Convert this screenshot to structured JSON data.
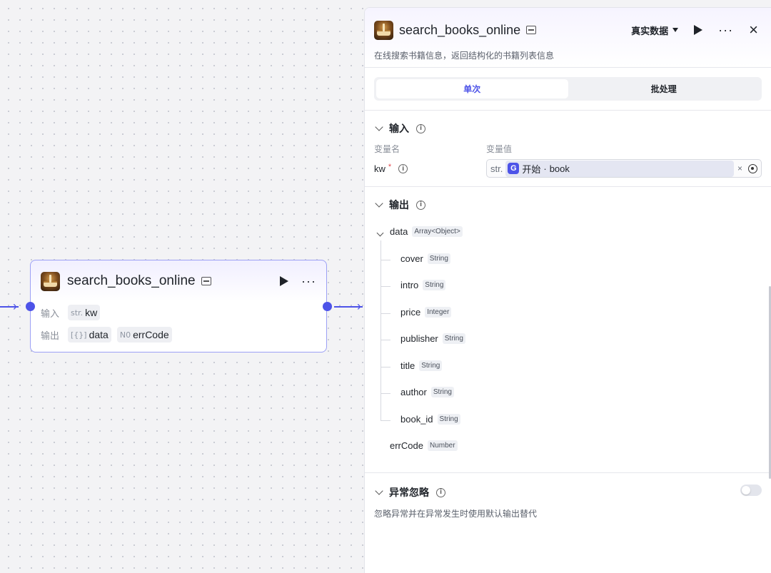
{
  "node": {
    "title": "search_books_online",
    "input_label": "输入",
    "output_label": "输出",
    "inputs": [
      {
        "type": "str.",
        "name": "kw"
      }
    ],
    "outputs": [
      {
        "type": "[{}]",
        "name": "data"
      },
      {
        "type": "N0",
        "name": "errCode"
      }
    ]
  },
  "panel": {
    "title": "search_books_online",
    "data_mode": "真实数据",
    "description": "在线搜索书籍信息，返回结构化的书籍列表信息",
    "tabs": [
      "单次",
      "批处理"
    ],
    "active_tab": "单次",
    "input_section": {
      "title": "输入",
      "col_name": "变量名",
      "col_value": "变量值",
      "var_name": "kw",
      "required_mark": "*",
      "value_type": "str.",
      "ref_node": "开始",
      "ref_sep": " · ",
      "ref_var": "book",
      "clear": "×"
    },
    "output_section": {
      "title": "输出",
      "root": {
        "name": "data",
        "type": "Array<Object>"
      },
      "children": [
        {
          "name": "cover",
          "type": "String"
        },
        {
          "name": "intro",
          "type": "String"
        },
        {
          "name": "price",
          "type": "Integer"
        },
        {
          "name": "publisher",
          "type": "String"
        },
        {
          "name": "title",
          "type": "String"
        },
        {
          "name": "author",
          "type": "String"
        },
        {
          "name": "book_id",
          "type": "String"
        }
      ],
      "extra": {
        "name": "errCode",
        "type": "Number"
      }
    },
    "ignore_section": {
      "title": "异常忽略",
      "description": "忽略异常并在异常发生时使用默认输出替代",
      "enabled": false
    }
  },
  "colors": {
    "accent": "#4d53e8",
    "node_border": "#9ca0f5"
  }
}
